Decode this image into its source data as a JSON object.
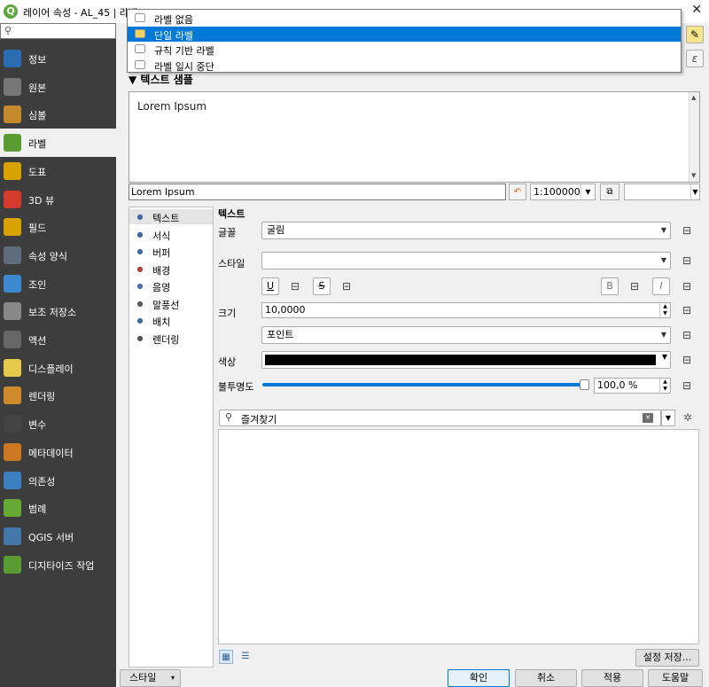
{
  "window": {
    "title": "레이어 속성 - AL_45 | 라벨",
    "close_symbol": "✕"
  },
  "sidebar": {
    "search_placeholder": "",
    "items": [
      {
        "label": "정보",
        "icon": "info-icon",
        "color": "#2b6cb0"
      },
      {
        "label": "원본",
        "icon": "source-icon",
        "color": "#777777"
      },
      {
        "label": "심볼",
        "icon": "symbology-icon",
        "color": "#c48a2c"
      },
      {
        "label": "라벨",
        "icon": "labels-icon",
        "color": "#5a9b32"
      },
      {
        "label": "도표",
        "icon": "diagrams-icon",
        "color": "#d8a200"
      },
      {
        "label": "3D 뷰",
        "icon": "3d-view-icon",
        "color": "#d33a2c"
      },
      {
        "label": "필드",
        "icon": "fields-icon",
        "color": "#d8a200"
      },
      {
        "label": "속성 양식",
        "icon": "attributes-form-icon",
        "color": "#5d6b7b"
      },
      {
        "label": "조인",
        "icon": "joins-icon",
        "color": "#3c89d0"
      },
      {
        "label": "보조 저장소",
        "icon": "auxiliary-storage-icon",
        "color": "#888888"
      },
      {
        "label": "액션",
        "icon": "actions-icon",
        "color": "#666666"
      },
      {
        "label": "디스플레이",
        "icon": "display-icon",
        "color": "#e6c84a"
      },
      {
        "label": "렌더링",
        "icon": "rendering-icon",
        "color": "#d08a2a"
      },
      {
        "label": "변수",
        "icon": "variables-icon",
        "color": "#444444"
      },
      {
        "label": "메타데이터",
        "icon": "metadata-icon",
        "color": "#cc7722"
      },
      {
        "label": "의존성",
        "icon": "dependencies-icon",
        "color": "#3c7fc0"
      },
      {
        "label": "범례",
        "icon": "legend-icon",
        "color": "#66aa33"
      },
      {
        "label": "QGIS 서버",
        "icon": "qgis-server-icon",
        "color": "#4477aa"
      },
      {
        "label": "디지타이즈 작업",
        "icon": "digitizing-icon",
        "color": "#5a9b32"
      }
    ]
  },
  "label_mode_popup": {
    "items": [
      {
        "label": "라벨 없음",
        "icon": "no-labels-icon",
        "selected": false
      },
      {
        "label": "단일 라벨",
        "icon": "single-labels-icon",
        "selected": true
      },
      {
        "label": "규칙 기반 라벨",
        "icon": "rule-based-labels-icon",
        "selected": false
      },
      {
        "label": "라벨 일시 중단",
        "icon": "blocking-labels-icon",
        "selected": false
      }
    ]
  },
  "preview": {
    "section_title": "텍스트 샘플",
    "sample_text": "Lorem Ipsum",
    "input_value": "Lorem Ipsum",
    "scale_value": "1:100000"
  },
  "sublist": {
    "items": [
      {
        "label": "텍스트",
        "icon": "text-icon"
      },
      {
        "label": "서식",
        "icon": "formatting-icon"
      },
      {
        "label": "버퍼",
        "icon": "buffer-icon"
      },
      {
        "label": "배경",
        "icon": "background-icon"
      },
      {
        "label": "음영",
        "icon": "shadow-icon"
      },
      {
        "label": "말풍선",
        "icon": "callouts-icon"
      },
      {
        "label": "배치",
        "icon": "placement-icon"
      },
      {
        "label": "렌더링",
        "icon": "rendering-icon"
      }
    ]
  },
  "text_panel": {
    "heading": "텍스트",
    "font_label": "글꼴",
    "font_value": "굴림",
    "style_label": "스타일",
    "style_value": "",
    "underline": "U",
    "strikeout": "S",
    "bold": "B",
    "italic": "I",
    "size_label": "크기",
    "size_value": "10,0000",
    "unit_value": "포인트",
    "color_label": "색상",
    "color_value": "#000000",
    "opacity_label": "불투명도",
    "opacity_value": "100,0 %",
    "opacity_fraction": 1.0,
    "favorites_text": "즐겨찾기"
  },
  "buttons": {
    "save_style": "설정 저장...",
    "style": "스타일",
    "ok": "확인",
    "cancel": "취소",
    "apply": "적용",
    "help": "도움말"
  }
}
